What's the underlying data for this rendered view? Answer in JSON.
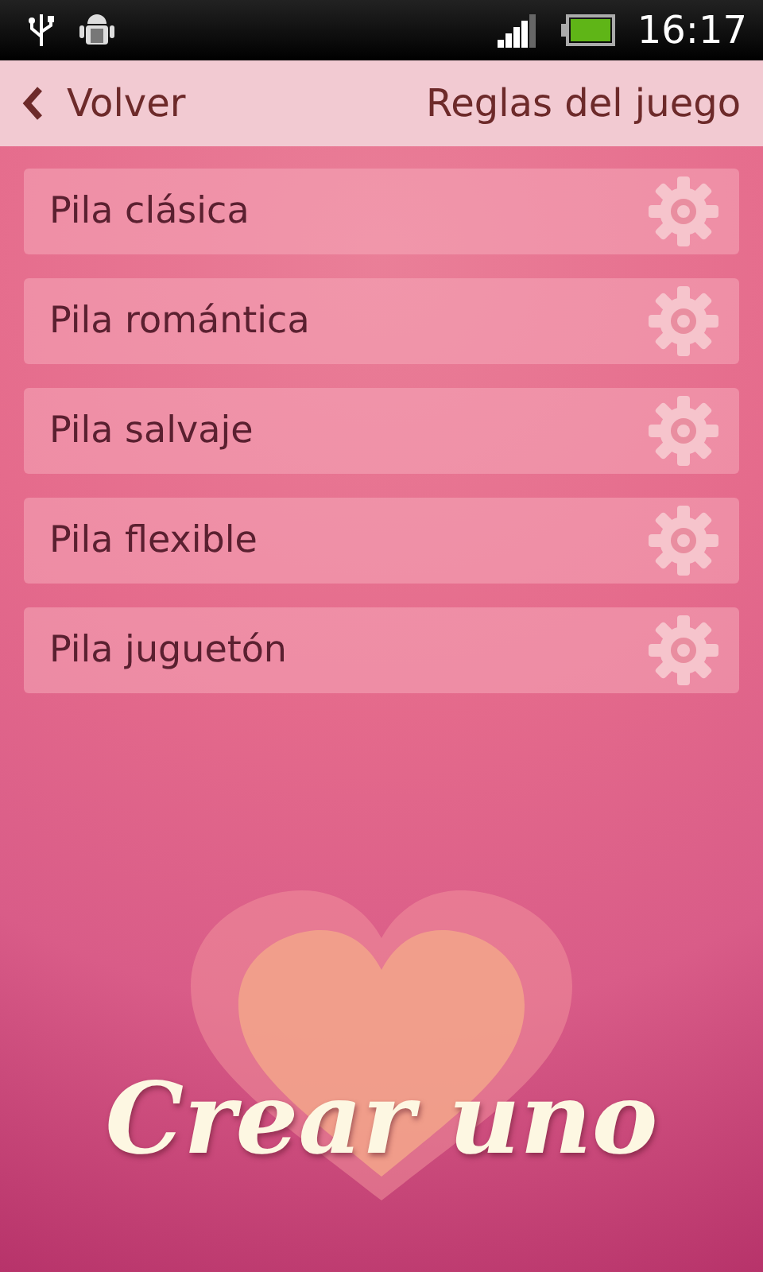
{
  "status_bar": {
    "time": "16:17"
  },
  "header": {
    "back_label": "Volver",
    "title": "Reglas del juego"
  },
  "piles": [
    {
      "label": "Pila clásica"
    },
    {
      "label": "Pila romántica"
    },
    {
      "label": "Pila salvaje"
    },
    {
      "label": "Pila flexible"
    },
    {
      "label": "Pila juguetón"
    }
  ],
  "create_button": {
    "label": "Crear uno"
  }
}
